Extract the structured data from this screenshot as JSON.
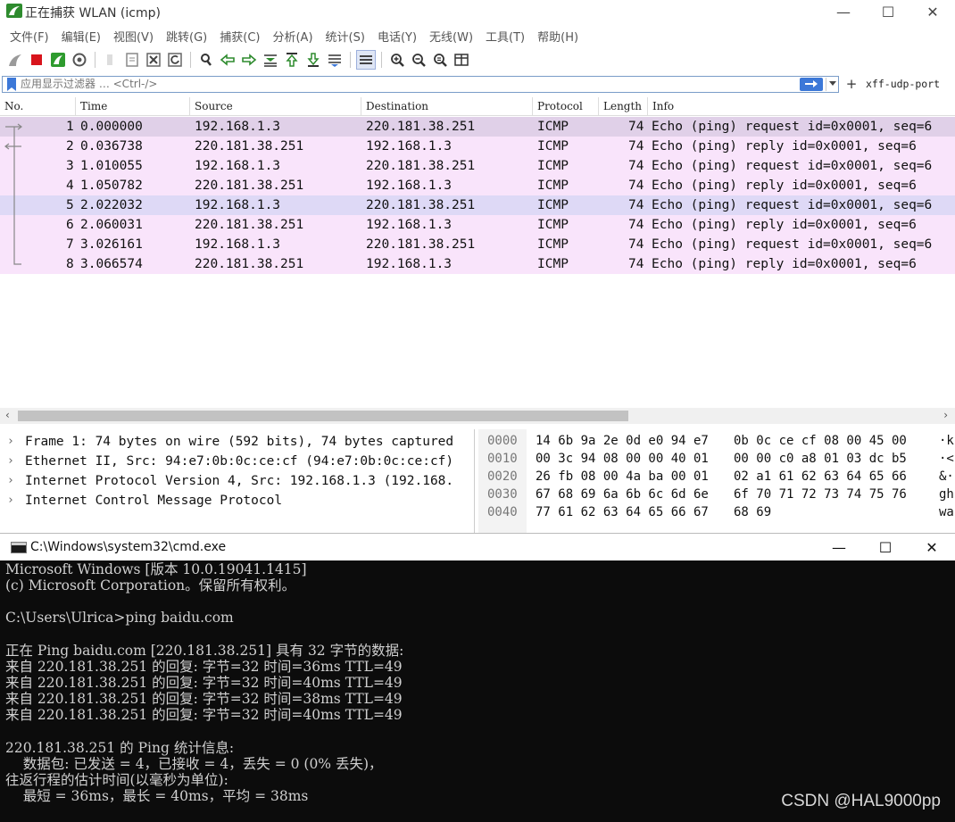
{
  "wireshark": {
    "title": "正在捕获 WLAN (icmp)",
    "window_controls": {
      "minimize": "—",
      "maximize": "☐",
      "close": "✕"
    },
    "menu": [
      "文件(F)",
      "编辑(E)",
      "视图(V)",
      "跳转(G)",
      "捕获(C)",
      "分析(A)",
      "统计(S)",
      "电话(Y)",
      "无线(W)",
      "工具(T)",
      "帮助(H)"
    ],
    "filter": {
      "placeholder": "应用显示过滤器 … <Ctrl-/>",
      "button_label": "xff-udp-port",
      "plus": "+"
    },
    "columns": [
      "No.",
      "Time",
      "Source",
      "Destination",
      "Protocol",
      "Length",
      "Info"
    ],
    "packets": [
      {
        "no": "1",
        "time": "0.000000",
        "src": "192.168.1.3",
        "dst": "220.181.38.251",
        "proto": "ICMP",
        "len": "74",
        "info": "Echo (ping) request  id=0x0001, seq=6"
      },
      {
        "no": "2",
        "time": "0.036738",
        "src": "220.181.38.251",
        "dst": "192.168.1.3",
        "proto": "ICMP",
        "len": "74",
        "info": "Echo (ping) reply    id=0x0001, seq=6"
      },
      {
        "no": "3",
        "time": "1.010055",
        "src": "192.168.1.3",
        "dst": "220.181.38.251",
        "proto": "ICMP",
        "len": "74",
        "info": "Echo (ping) request  id=0x0001, seq=6"
      },
      {
        "no": "4",
        "time": "1.050782",
        "src": "220.181.38.251",
        "dst": "192.168.1.3",
        "proto": "ICMP",
        "len": "74",
        "info": "Echo (ping) reply    id=0x0001, seq=6"
      },
      {
        "no": "5",
        "time": "2.022032",
        "src": "192.168.1.3",
        "dst": "220.181.38.251",
        "proto": "ICMP",
        "len": "74",
        "info": "Echo (ping) request  id=0x0001, seq=6"
      },
      {
        "no": "6",
        "time": "2.060031",
        "src": "220.181.38.251",
        "dst": "192.168.1.3",
        "proto": "ICMP",
        "len": "74",
        "info": "Echo (ping) reply    id=0x0001, seq=6"
      },
      {
        "no": "7",
        "time": "3.026161",
        "src": "192.168.1.3",
        "dst": "220.181.38.251",
        "proto": "ICMP",
        "len": "74",
        "info": "Echo (ping) request  id=0x0001, seq=6"
      },
      {
        "no": "8",
        "time": "3.066574",
        "src": "220.181.38.251",
        "dst": "192.168.1.3",
        "proto": "ICMP",
        "len": "74",
        "info": "Echo (ping) reply    id=0x0001, seq=6"
      }
    ],
    "details": [
      "Frame 1: 74 bytes on wire (592 bits), 74 bytes captured",
      "Ethernet II, Src: 94:e7:0b:0c:ce:cf (94:e7:0b:0c:ce:cf)",
      "Internet Protocol Version 4, Src: 192.168.1.3 (192.168.",
      "Internet Control Message Protocol"
    ],
    "bytes": [
      {
        "offset": "0000",
        "hex1": "14 6b 9a 2e 0d e0 94 e7",
        "hex2": "0b 0c ce cf 08 00 45 00",
        "ascii": "·k"
      },
      {
        "offset": "0010",
        "hex1": "00 3c 94 08 00 00 40 01",
        "hex2": "00 00 c0 a8 01 03 dc b5",
        "ascii": "·<"
      },
      {
        "offset": "0020",
        "hex1": "26 fb 08 00 4a ba 00 01",
        "hex2": "02 a1 61 62 63 64 65 66",
        "ascii": "&·"
      },
      {
        "offset": "0030",
        "hex1": "67 68 69 6a 6b 6c 6d 6e",
        "hex2": "6f 70 71 72 73 74 75 76",
        "ascii": "gh"
      },
      {
        "offset": "0040",
        "hex1": "77 61 62 63 64 65 66 67",
        "hex2": "68 69",
        "ascii": "wa"
      }
    ],
    "colors": {
      "row": "#f9e4fb",
      "selected": "#e0d0e8",
      "highlight": "#ded9f6",
      "accent": "#3c78d8"
    }
  },
  "cmd": {
    "title": "C:\\Windows\\system32\\cmd.exe",
    "window_controls": {
      "minimize": "—",
      "maximize": "☐",
      "close": "✕"
    },
    "lines": [
      "Microsoft Windows [版本 10.0.19041.1415]",
      "(c) Microsoft Corporation。保留所有权利。",
      "",
      "C:\\Users\\Ulrica>ping baidu.com",
      "",
      "正在 Ping baidu.com [220.181.38.251] 具有 32 字节的数据:",
      "来自 220.181.38.251 的回复: 字节=32 时间=36ms TTL=49",
      "来自 220.181.38.251 的回复: 字节=32 时间=40ms TTL=49",
      "来自 220.181.38.251 的回复: 字节=32 时间=38ms TTL=49",
      "来自 220.181.38.251 的回复: 字节=32 时间=40ms TTL=49",
      "",
      "220.181.38.251 的 Ping 统计信息:",
      "    数据包: 已发送 = 4，已接收 = 4，丢失 = 0 (0% 丢失)，",
      "往返行程的估计时间(以毫秒为单位):",
      "    最短 = 36ms，最长 = 40ms，平均 = 38ms"
    ],
    "watermark": "CSDN @HAL9000pp"
  }
}
